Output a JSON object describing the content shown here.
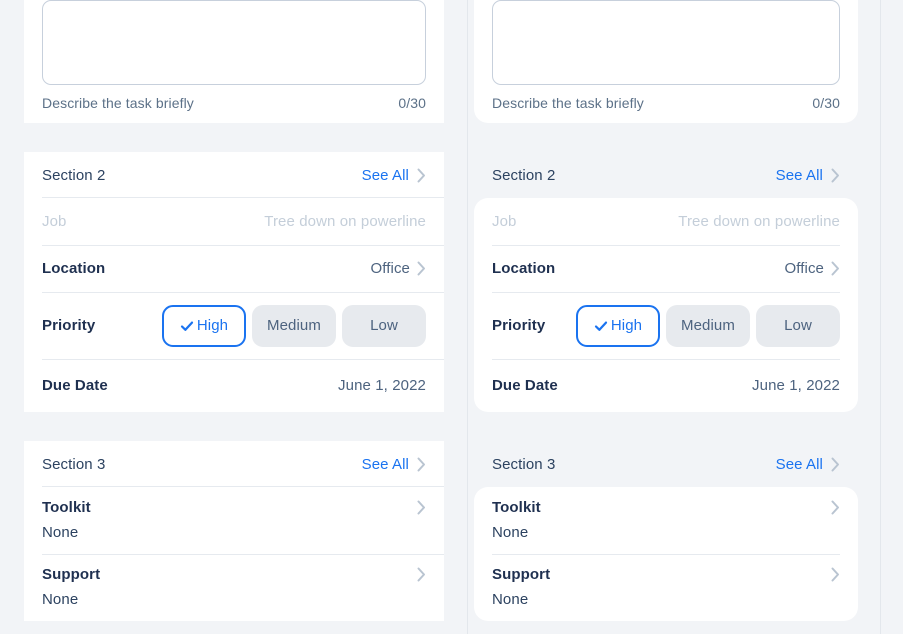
{
  "theme": {
    "page_bg": "#f2f4f7",
    "card_bg": "#ffffff",
    "accent_blue": "#1a73f0",
    "label_dark": "#1f3050",
    "value_slate": "#4d637f",
    "disabled_gray": "#c4ced9",
    "pill_gray": "#e7eaee",
    "divider": "#e6eaef"
  },
  "description": {
    "value": "",
    "placeholder": "",
    "hint": "Describe the task briefly",
    "counter": "0/30"
  },
  "section2": {
    "title": "Section 2",
    "see_all": "See All",
    "see_all_icon": "chevron-right-icon",
    "rows": {
      "job": {
        "label": "Job",
        "value": "Tree down on powerline",
        "disabled": true
      },
      "location": {
        "label": "Location",
        "value": "Office",
        "chevron": "chevron-right-icon"
      },
      "priority": {
        "label": "Priority",
        "options": [
          "High",
          "Medium",
          "Low"
        ],
        "selected": "High",
        "check_icon": "check-icon"
      },
      "due_date": {
        "label": "Due Date",
        "value": "June 1, 2022"
      }
    }
  },
  "section3": {
    "title": "Section 3",
    "see_all": "See All",
    "see_all_icon": "chevron-right-icon",
    "rows": [
      {
        "label": "Toolkit",
        "value": "None",
        "chevron": "chevron-right-icon"
      },
      {
        "label": "Support",
        "value": "None",
        "chevron": "chevron-right-icon"
      }
    ]
  }
}
